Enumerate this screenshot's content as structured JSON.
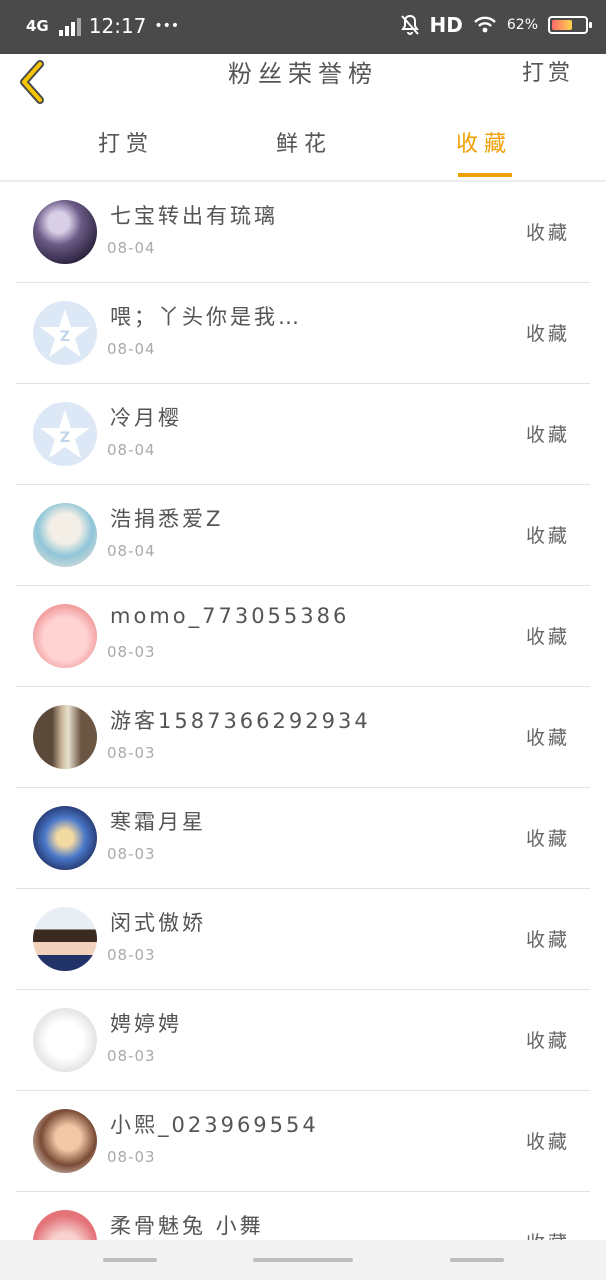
{
  "status_bar": {
    "network": "4G",
    "time": "12:17",
    "dots": "•••",
    "hd": "HD",
    "battery_percent": "62%",
    "battery_level": 0.62
  },
  "header": {
    "title": "粉丝荣誉榜",
    "right_label": "打赏",
    "back_icon": "chevron-left-icon",
    "accent_color": "#f0a000"
  },
  "tabs": [
    {
      "label": "打赏",
      "active": false
    },
    {
      "label": "鲜花",
      "active": false
    },
    {
      "label": "收藏",
      "active": true
    }
  ],
  "list": [
    {
      "name": "七宝转出有琉璃",
      "date": "08-04",
      "action": "收藏",
      "avatar": "photo"
    },
    {
      "name": "喂；丫头你是我…",
      "date": "08-04",
      "action": "收藏",
      "avatar": "default"
    },
    {
      "name": "冷月樱",
      "date": "08-04",
      "action": "收藏",
      "avatar": "default"
    },
    {
      "name": "浩捐悉爱Z",
      "date": "08-04",
      "action": "收藏",
      "avatar": "anime-blue"
    },
    {
      "name": "momo_773055386",
      "date": "08-03",
      "action": "收藏",
      "avatar": "pink-cartoon"
    },
    {
      "name": "游客1587366292934",
      "date": "08-03",
      "action": "收藏",
      "avatar": "photo-dark"
    },
    {
      "name": "寒霜月星",
      "date": "08-03",
      "action": "收藏",
      "avatar": "anime-night"
    },
    {
      "name": "闵式傲娇",
      "date": "08-03",
      "action": "收藏",
      "avatar": "photo-person"
    },
    {
      "name": "娉婷娉",
      "date": "08-03",
      "action": "收藏",
      "avatar": "anime-white"
    },
    {
      "name": "小熙_023969554",
      "date": "08-03",
      "action": "收藏",
      "avatar": "photo-warm"
    },
    {
      "name": "柔骨魅兔 小舞",
      "date": "",
      "action": "收藏",
      "avatar": "anime-pink"
    }
  ]
}
